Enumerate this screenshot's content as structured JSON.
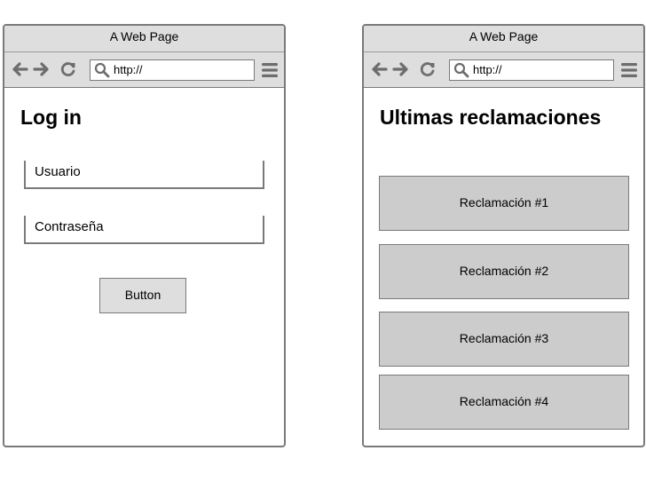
{
  "login_window": {
    "title": "A Web Page",
    "url": "http://",
    "heading": "Log in",
    "username_label": "Usuario",
    "password_label": "Contraseña",
    "button_label": "Button"
  },
  "claims_window": {
    "title": "A Web Page",
    "url": "http://",
    "heading": "Ultimas reclamaciones",
    "claims": [
      "Reclamación #1",
      "Reclamación #2",
      "Reclamación #3",
      "Reclamación #4"
    ]
  },
  "icons": {
    "back": "arrow-left-icon",
    "forward": "arrow-right-icon",
    "reload": "reload-icon",
    "search": "search-icon",
    "menu": "hamburger-menu-icon"
  },
  "colors": {
    "chrome": "#dedede",
    "border": "#7a7a7a",
    "claim_fill": "#cccccc"
  }
}
